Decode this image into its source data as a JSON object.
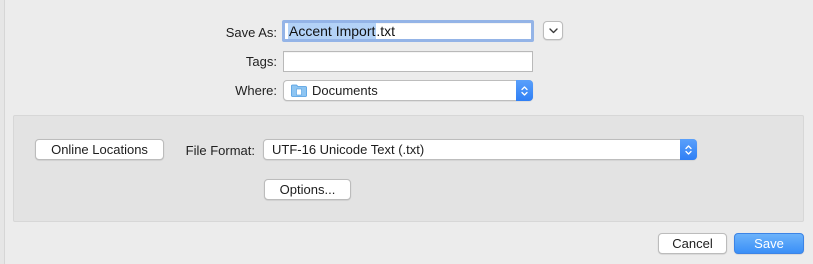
{
  "dialog": {
    "save_as": {
      "label": "Save As:",
      "filename_selected": "Accent Import",
      "filename_extension": ".txt"
    },
    "tags": {
      "label": "Tags:",
      "value": ""
    },
    "where": {
      "label": "Where:",
      "value": "Documents",
      "icon": "folder-icon"
    },
    "expand_button": {
      "icon": "chevron-down-icon"
    },
    "options_panel": {
      "online_locations_label": "Online Locations",
      "file_format_label": "File Format:",
      "file_format_value": "UTF-16 Unicode Text (.txt)",
      "options_label": "Options..."
    },
    "buttons": {
      "cancel_label": "Cancel",
      "save_label": "Save"
    },
    "colors": {
      "accent": "#3a8ff7",
      "selection": "#b3d2f7",
      "focus_ring": "#94b4e7"
    }
  }
}
